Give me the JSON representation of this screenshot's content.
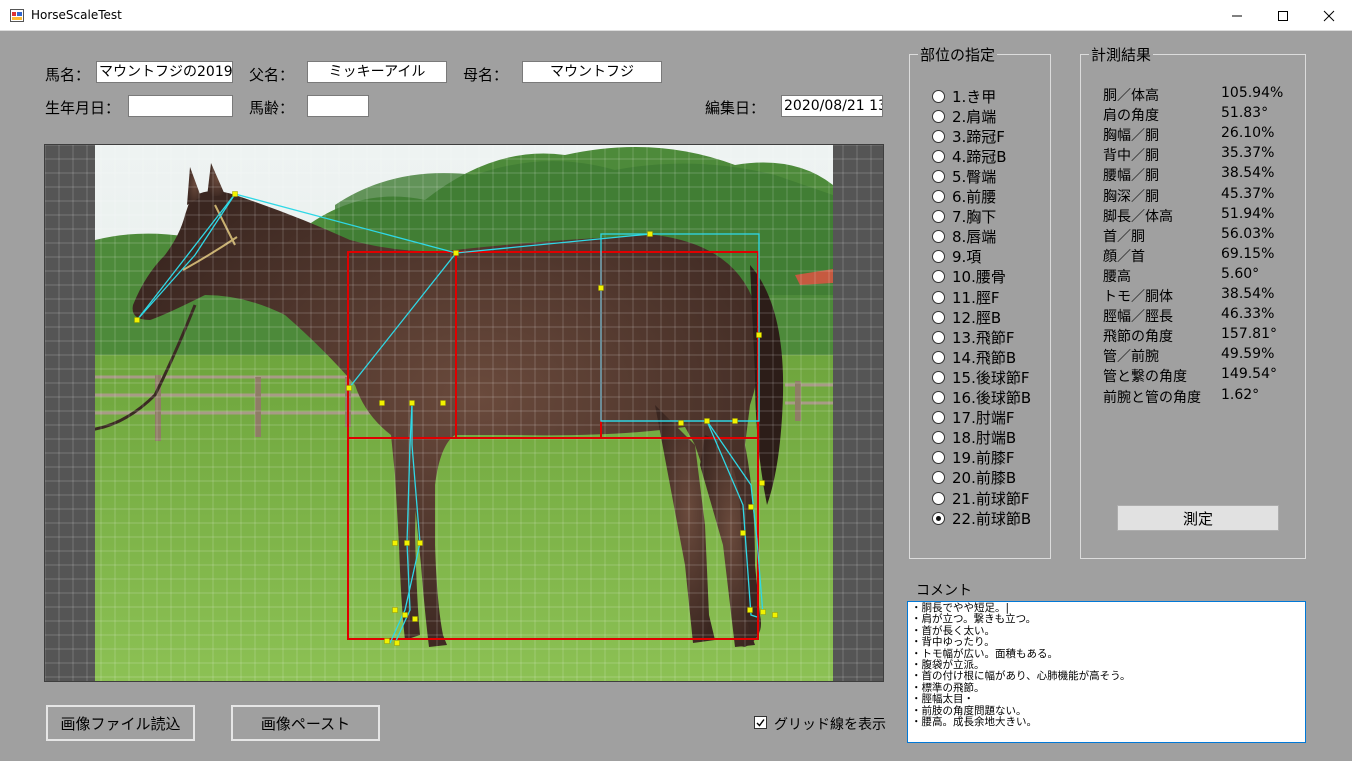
{
  "window": {
    "title": "HorseScaleTest",
    "minimize": "—",
    "maximize": "☐",
    "close": "✕"
  },
  "form": {
    "horse_name_label": "馬名：",
    "horse_name_value": "マウントフジの2019",
    "sire_label": "父名：",
    "sire_value": "ミッキーアイル",
    "dam_label": "母名：",
    "dam_value": "マウントフジ",
    "birthdate_label": "生年月日：",
    "birthdate_value": "",
    "age_label": "馬齢：",
    "age_value": "",
    "edit_date_label": "編集日：",
    "edit_date_value": "2020/08/21 13"
  },
  "body_parts": {
    "title": "部位の指定",
    "selected": 22,
    "items": [
      "1.き甲",
      "2.肩端",
      "3.蹄冠F",
      "4.蹄冠B",
      "5.臀端",
      "6.前腰",
      "7.胸下",
      "8.唇端",
      "9.項",
      "10.腰骨",
      "11.脛F",
      "12.脛B",
      "13.飛節F",
      "14.飛節B",
      "15.後球節F",
      "16.後球節B",
      "17.肘端F",
      "18.肘端B",
      "19.前膝F",
      "20.前膝B",
      "21.前球節F",
      "22.前球節B"
    ]
  },
  "results": {
    "title": "計測結果",
    "rows": [
      {
        "label": "胴／体高",
        "value": "105.94%"
      },
      {
        "label": "肩の角度",
        "value": "51.83°"
      },
      {
        "label": "胸幅／胴",
        "value": "26.10%"
      },
      {
        "label": "背中／胴",
        "value": "35.37%"
      },
      {
        "label": "腰幅／胴",
        "value": "38.54%"
      },
      {
        "label": "胸深／胴",
        "value": "45.37%"
      },
      {
        "label": "脚長／体高",
        "value": "51.94%"
      },
      {
        "label": "首／胴",
        "value": "56.03%"
      },
      {
        "label": "顔／首",
        "value": "69.15%"
      },
      {
        "label": "腰高",
        "value": "5.60°"
      },
      {
        "label": "トモ／胴体",
        "value": "38.54%"
      },
      {
        "label": "脛幅／脛長",
        "value": "46.33%"
      },
      {
        "label": "飛節の角度",
        "value": "157.81°"
      },
      {
        "label": "管／前腕",
        "value": "49.59%"
      },
      {
        "label": "管と繋の角度",
        "value": "149.54°"
      },
      {
        "label": "前腕と管の角度",
        "value": "1.62°"
      }
    ],
    "measure_button": "測定"
  },
  "comment": {
    "label": "コメント",
    "lines": [
      "・胴長でやや短足。|",
      "・肩が立つ。繋きも立つ。",
      "・首が長く太い。",
      "・背中ゆったり。",
      "・トモ幅が広い。面積もある。",
      "・腹袋が立派。",
      "・首の付け根に幅があり、心肺機能が高そう。",
      "・標準の飛節。",
      "・脛幅太目・",
      "・前肢の角度問題ない。",
      "・腰高。成長余地大きい。"
    ]
  },
  "buttons": {
    "load_image": "画像ファイル読込",
    "paste_image": "画像ペースト"
  },
  "grid_toggle": {
    "label": "グリッド線を表示",
    "checked": true
  },
  "colors": {
    "measure_box": "#e00000",
    "skeleton_line": "#2fd8e6",
    "landmark_point": "#f2f200",
    "grid_line": "#ffffff"
  }
}
